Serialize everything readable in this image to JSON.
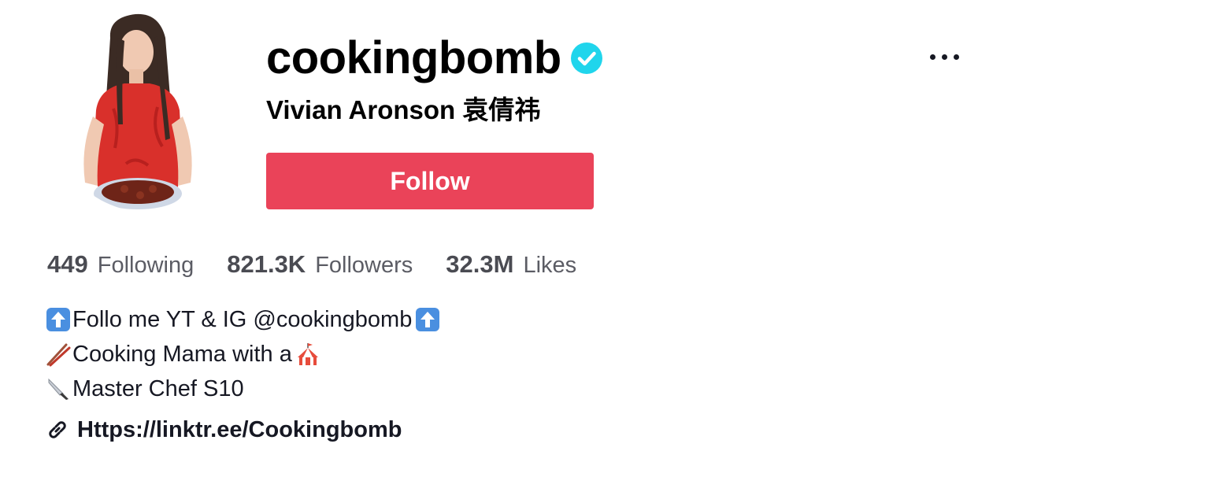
{
  "profile": {
    "username": "cookingbomb",
    "nickname": "Vivian Aronson 袁倩祎",
    "verified": true,
    "avatar_icon": "avatar-photo"
  },
  "actions": {
    "follow_label": "Follow",
    "more_icon": "more-horizontal-icon"
  },
  "stats": [
    {
      "value": "449",
      "label": "Following"
    },
    {
      "value": "821.3K",
      "label": "Followers"
    },
    {
      "value": "32.3M",
      "label": "Likes"
    }
  ],
  "bio": [
    {
      "icon": "up-arrow-emoji",
      "text": "Follo me YT & IG @cookingbomb",
      "trailing_icon": "up-arrow-emoji"
    },
    {
      "icon": "chopsticks-emoji",
      "text": "Cooking Mama with a",
      "trailing_icon": "circus-tent-emoji"
    },
    {
      "icon": "kitchen-knife-emoji",
      "text": "Master Chef S10"
    }
  ],
  "link": {
    "icon": "link-icon",
    "text": "Https://linktr.ee/Cookingbomb"
  },
  "colors": {
    "follow_button": "#ea4359",
    "verified_badge": "#20d5ec",
    "text_primary": "#161823",
    "text_secondary": "#5b5c64"
  }
}
